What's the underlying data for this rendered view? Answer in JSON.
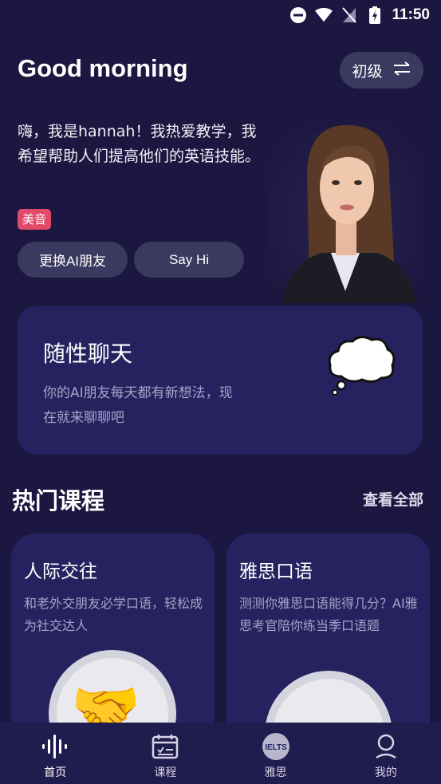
{
  "status_bar": {
    "time": "11:50"
  },
  "header": {
    "greeting": "Good morning",
    "level_label": "初级"
  },
  "intro": {
    "text": "嗨，我是hannah！我热爱教学，我希望帮助人们提高他们的英语技能。",
    "accent_badge": "美音",
    "change_friend_label": "更换AI朋友",
    "say_hi_label": "Say Hi"
  },
  "chat_card": {
    "title": "随性聊天",
    "description": "你的AI朋友每天都有新想法，现在就来聊聊吧"
  },
  "courses": {
    "section_title": "热门课程",
    "view_all_label": "查看全部",
    "items": [
      {
        "title": "人际交往",
        "description": "和老外交朋友必学口语，轻松成为社交达人"
      },
      {
        "title": "雅思口语",
        "description": "测测你雅思口语能得几分？AI雅思考官陪你练当季口语题"
      }
    ]
  },
  "bottom_nav": {
    "items": [
      {
        "label": "首页",
        "icon": "voice-wave-icon"
      },
      {
        "label": "课程",
        "icon": "calendar-check-icon"
      },
      {
        "label": "雅思",
        "icon": "ielts-icon",
        "badge_text": "IELTS"
      },
      {
        "label": "我的",
        "icon": "profile-icon"
      }
    ]
  },
  "colors": {
    "background": "#1b1740",
    "card": "#262260",
    "pill": "#3b3960",
    "accent_badge": "#e24a6a",
    "nav_bar": "#211c4e"
  }
}
